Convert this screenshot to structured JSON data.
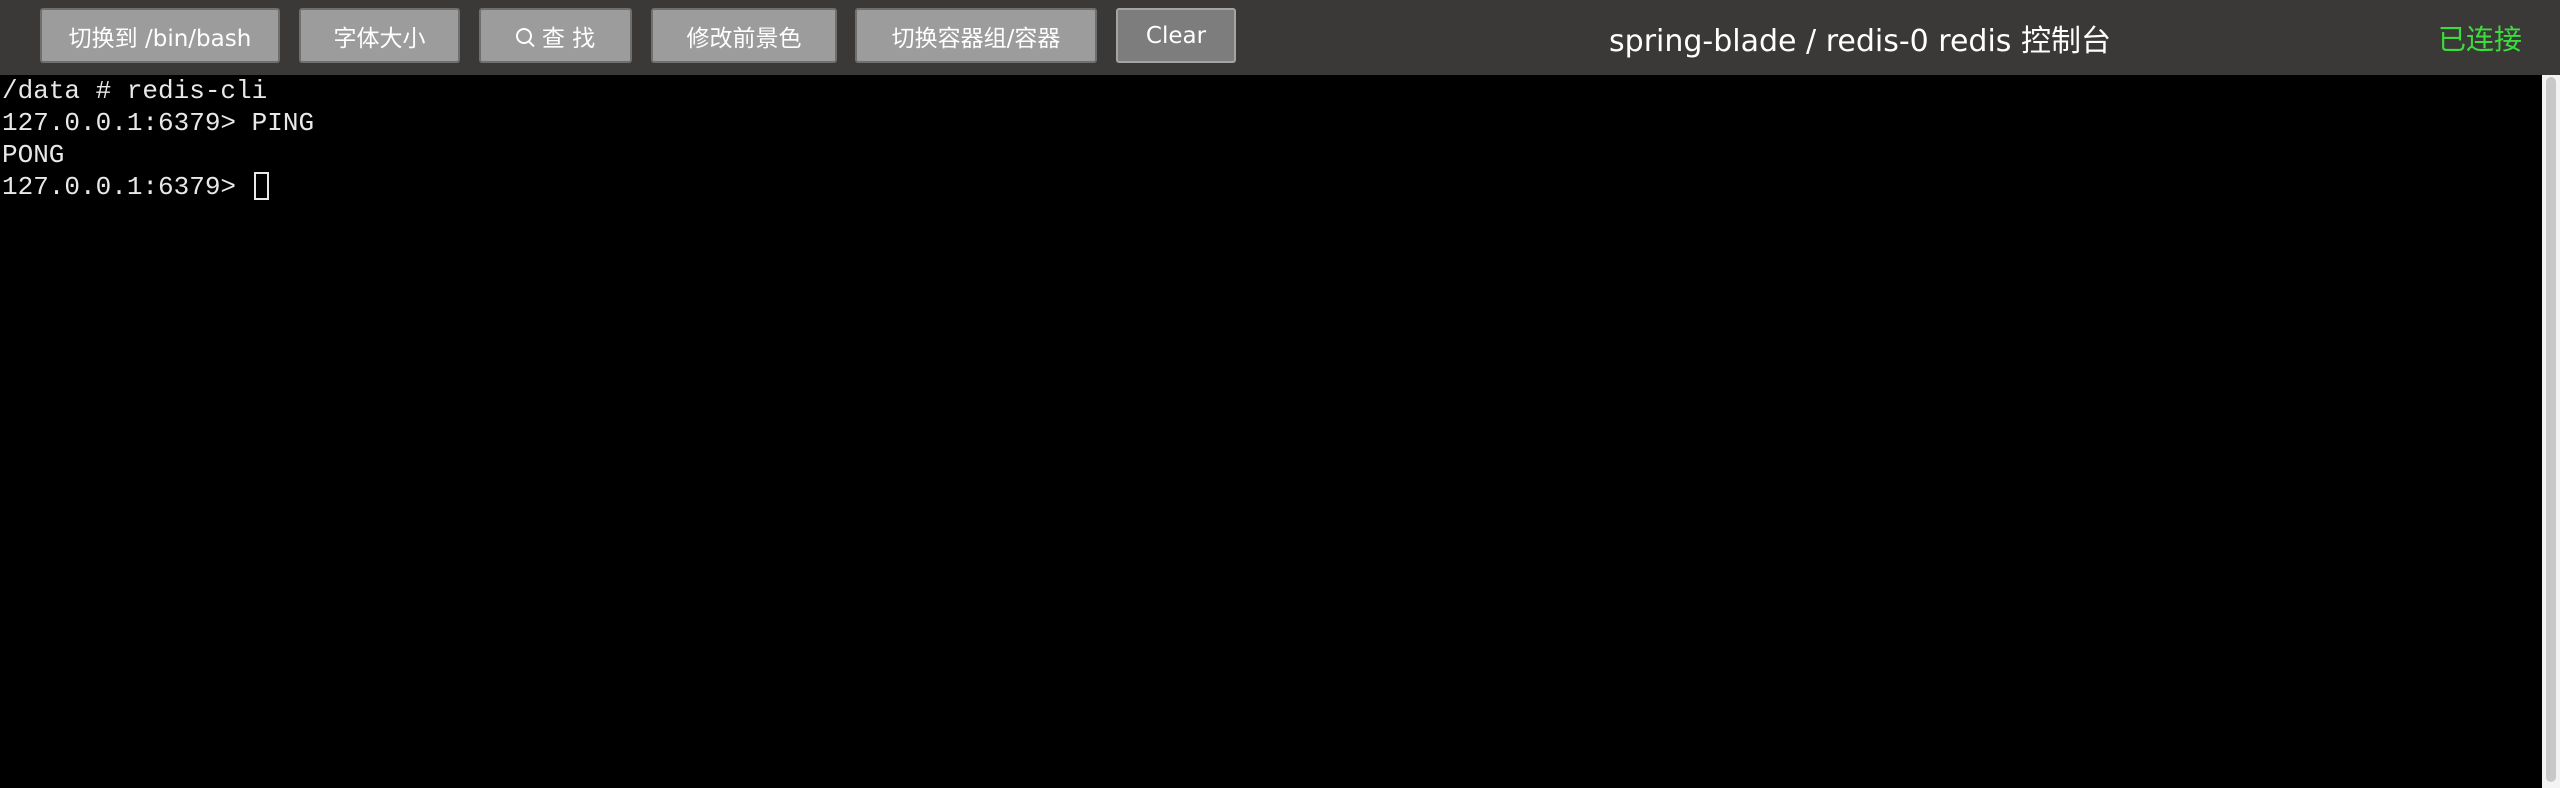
{
  "toolbar": {
    "switch_shell_label": "切换到 /bin/bash",
    "font_size_label": "字体大小",
    "search_label": "查 找",
    "foreground_label": "修改前景色",
    "switch_container_label": "切换容器组/容器",
    "clear_label": "Clear"
  },
  "title": "spring-blade / redis-0 redis 控制台",
  "status": {
    "text": "已连接",
    "color": "#3ddc3d"
  },
  "icons": {
    "search": "search-icon"
  },
  "terminal": {
    "lines": [
      "/data # redis-cli",
      "127.0.0.1:6379> PING",
      "PONG"
    ],
    "prompt": "127.0.0.1:6379> "
  }
}
